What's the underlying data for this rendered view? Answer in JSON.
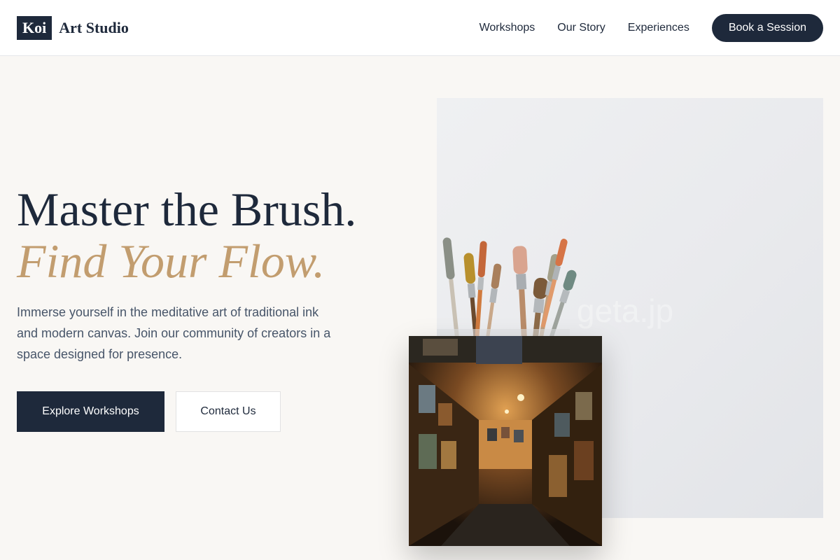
{
  "header": {
    "logo_box": "Koi",
    "logo_text": "Art Studio",
    "nav": [
      {
        "label": "Workshops"
      },
      {
        "label": "Our Story"
      },
      {
        "label": "Experiences"
      }
    ],
    "cta_label": "Book a Session"
  },
  "hero": {
    "title_line1": "Master the Brush.",
    "title_line2": "Find Your Flow.",
    "description": "Immerse yourself in the meditative art of traditional ink and modern canvas. Join our community of creators in a space designed for presence.",
    "primary_button": "Explore Workshops",
    "secondary_button": "Contact Us"
  },
  "images": {
    "main_watermark": "geta.jp"
  },
  "colors": {
    "primary": "#1e293b",
    "accent": "#c29d6f",
    "background": "#f9f7f4",
    "body_text": "#475569"
  }
}
